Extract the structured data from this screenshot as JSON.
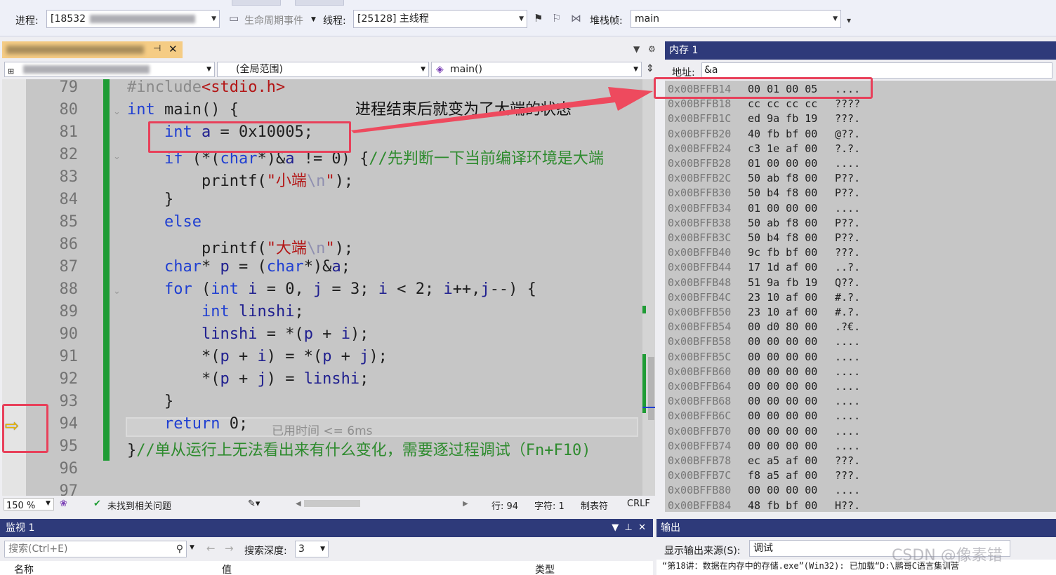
{
  "toolbar": {
    "process_label": "进程:",
    "process_value": "[18532",
    "lifecycle_label": "生命周期事件",
    "thread_label": "线程:",
    "thread_value": "[25128] 主线程",
    "stackframe_label": "堆栈帧:",
    "stackframe_value": "main"
  },
  "editor": {
    "scope_value": "(全局范围)",
    "function_value": "main()",
    "lines": [
      {
        "no": "79",
        "html": "<span class=\"pp\">#include</span><span class=\"str\">&lt;stdio.h&gt;</span>"
      },
      {
        "no": "80",
        "html": "<span class=\"kw\">int</span> main() {"
      },
      {
        "no": "81",
        "html": "    <span class=\"kw\">int</span> <span class=\"var\">a</span> = 0x10005;"
      },
      {
        "no": "82",
        "html": "    <span class=\"kw\">if</span> (*(<span class=\"kw\">char</span>*)&amp;<span class=\"var\">a</span> != 0) {<span class=\"cmt\">//先判断一下当前编译环境是大端</span>"
      },
      {
        "no": "83",
        "html": "        printf(<span class=\"str\">\"小端<span class=\"esc\">\\n</span>\"</span>);"
      },
      {
        "no": "84",
        "html": "    }"
      },
      {
        "no": "85",
        "html": "    <span class=\"kw\">else</span>"
      },
      {
        "no": "86",
        "html": "        printf(<span class=\"str\">\"大端<span class=\"esc\">\\n</span>\"</span>);"
      },
      {
        "no": "87",
        "html": "    <span class=\"kw\">char</span>* <span class=\"var\">p</span> = (<span class=\"kw\">char</span>*)&amp;<span class=\"var\">a</span>;"
      },
      {
        "no": "88",
        "html": "    <span class=\"kw\">for</span> (<span class=\"kw\">int</span> <span class=\"var\">i</span> = 0, <span class=\"var\">j</span> = 3; <span class=\"var\">i</span> &lt; 2; <span class=\"var\">i</span>++,<span class=\"var\">j</span>--) {"
      },
      {
        "no": "89",
        "html": "        <span class=\"kw\">int</span> <span class=\"var\">linshi</span>;"
      },
      {
        "no": "90",
        "html": "        <span class=\"var\">linshi</span> = *(<span class=\"var\">p</span> + <span class=\"var\">i</span>);"
      },
      {
        "no": "91",
        "html": "        *(<span class=\"var\">p</span> + <span class=\"var\">i</span>) = *(<span class=\"var\">p</span> + <span class=\"var\">j</span>);"
      },
      {
        "no": "92",
        "html": "        *(<span class=\"var\">p</span> + <span class=\"var\">j</span>) = <span class=\"var\">linshi</span>;"
      },
      {
        "no": "93",
        "html": "    }"
      },
      {
        "no": "94",
        "html": "    <span class=\"kw\">return</span> 0;"
      },
      {
        "no": "95",
        "html": "}<span class=\"cmt\">//单从运行上无法看出来有什么变化，需要逐过程调试（Fn+F10)</span>"
      },
      {
        "no": "96",
        "html": ""
      },
      {
        "no": "97",
        "html": ""
      }
    ],
    "elapsed": "已用时间 <= 6ms",
    "annotation": "进程结束后就变为了大端的状态"
  },
  "status": {
    "zoom": "150 %",
    "issues": "未找到相关问题",
    "line": "行: 94",
    "char": "字符: 1",
    "tab": "制表符",
    "eol": "CRLF"
  },
  "memory": {
    "title": "内存 1",
    "address_label": "地址:",
    "address_value": "&a",
    "rows": [
      {
        "addr": "0x00BFFB14",
        "bytes": "00 01 00 05",
        "chars": "...."
      },
      {
        "addr": "0x00BFFB18",
        "bytes": "cc cc cc cc",
        "chars": "????"
      },
      {
        "addr": "0x00BFFB1C",
        "bytes": "ed 9a fb 19",
        "chars": "???."
      },
      {
        "addr": "0x00BFFB20",
        "bytes": "40 fb bf 00",
        "chars": "@??."
      },
      {
        "addr": "0x00BFFB24",
        "bytes": "c3 1e af 00",
        "chars": "?.?."
      },
      {
        "addr": "0x00BFFB28",
        "bytes": "01 00 00 00",
        "chars": "...."
      },
      {
        "addr": "0x00BFFB2C",
        "bytes": "50 ab f8 00",
        "chars": "P??."
      },
      {
        "addr": "0x00BFFB30",
        "bytes": "50 b4 f8 00",
        "chars": "P??."
      },
      {
        "addr": "0x00BFFB34",
        "bytes": "01 00 00 00",
        "chars": "...."
      },
      {
        "addr": "0x00BFFB38",
        "bytes": "50 ab f8 00",
        "chars": "P??."
      },
      {
        "addr": "0x00BFFB3C",
        "bytes": "50 b4 f8 00",
        "chars": "P??."
      },
      {
        "addr": "0x00BFFB40",
        "bytes": "9c fb bf 00",
        "chars": "???."
      },
      {
        "addr": "0x00BFFB44",
        "bytes": "17 1d af 00",
        "chars": "..?."
      },
      {
        "addr": "0x00BFFB48",
        "bytes": "51 9a fb 19",
        "chars": "Q??."
      },
      {
        "addr": "0x00BFFB4C",
        "bytes": "23 10 af 00",
        "chars": "#.?."
      },
      {
        "addr": "0x00BFFB50",
        "bytes": "23 10 af 00",
        "chars": "#.?."
      },
      {
        "addr": "0x00BFFB54",
        "bytes": "00 d0 80 00",
        "chars": ".?€."
      },
      {
        "addr": "0x00BFFB58",
        "bytes": "00 00 00 00",
        "chars": "...."
      },
      {
        "addr": "0x00BFFB5C",
        "bytes": "00 00 00 00",
        "chars": "...."
      },
      {
        "addr": "0x00BFFB60",
        "bytes": "00 00 00 00",
        "chars": "...."
      },
      {
        "addr": "0x00BFFB64",
        "bytes": "00 00 00 00",
        "chars": "...."
      },
      {
        "addr": "0x00BFFB68",
        "bytes": "00 00 00 00",
        "chars": "...."
      },
      {
        "addr": "0x00BFFB6C",
        "bytes": "00 00 00 00",
        "chars": "...."
      },
      {
        "addr": "0x00BFFB70",
        "bytes": "00 00 00 00",
        "chars": "...."
      },
      {
        "addr": "0x00BFFB74",
        "bytes": "00 00 00 00",
        "chars": "...."
      },
      {
        "addr": "0x00BFFB78",
        "bytes": "ec a5 af 00",
        "chars": "???."
      },
      {
        "addr": "0x00BFFB7C",
        "bytes": "f8 a5 af 00",
        "chars": "???."
      },
      {
        "addr": "0x00BFFB80",
        "bytes": "00 00 00 00",
        "chars": "...."
      },
      {
        "addr": "0x00BFFB84",
        "bytes": "48 fb bf 00",
        "chars": "H??."
      }
    ]
  },
  "watch": {
    "title": "监视 1",
    "search_placeholder": "搜索(Ctrl+E)",
    "depth_label": "搜索深度:",
    "depth_value": "3",
    "col_name": "名称",
    "col_value": "值",
    "col_type": "类型"
  },
  "output": {
    "title": "输出",
    "source_label": "显示输出来源(S):",
    "source_value": "调试",
    "text": "“第18讲：数据在内存中的存储.exe”(Win32): 已加载“D:\\鹏哥C语言集训营",
    "watermark": "CSDN @像素错"
  }
}
